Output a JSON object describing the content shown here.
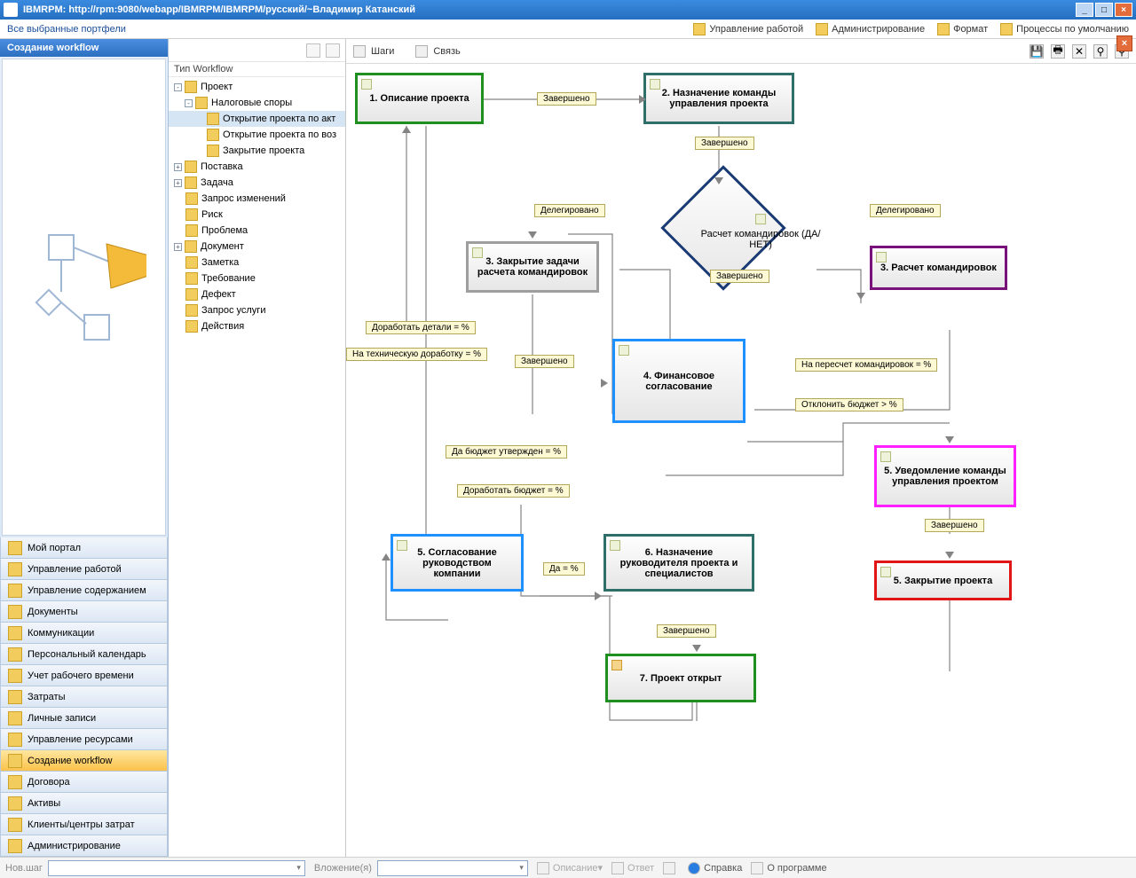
{
  "titlebar": "IBMRPM: http://rpm:9080/webapp/IBMRPM/IBMRPM/русский/~Владимир Катанский",
  "topbar": {
    "left": "Все выбранные портфели",
    "items": [
      "Управление работой",
      "Администрирование",
      "Формат",
      "Процессы по умолчанию"
    ]
  },
  "left": {
    "title": "Создание workflow",
    "nav": [
      "Мой портал",
      "Управление работой",
      "Управление содержанием",
      "Документы",
      "Коммуникации",
      "Персональный календарь",
      "Учет рабочего времени",
      "Затраты",
      "Личные записи",
      "Управление ресурсами",
      "Создание workflow",
      "Договора",
      "Активы",
      "Клиенты/центры затрат",
      "Администрирование"
    ],
    "selected": 10
  },
  "tree": {
    "header": "Тип Workflow",
    "rows": [
      {
        "lvl": 0,
        "exp": "-",
        "label": "Проект"
      },
      {
        "lvl": 1,
        "exp": "-",
        "label": "Налоговые споры"
      },
      {
        "lvl": 2,
        "exp": "",
        "label": "Открытие проекта по акт",
        "sel": true
      },
      {
        "lvl": 2,
        "exp": "",
        "label": "Открытие проекта по воз"
      },
      {
        "lvl": 2,
        "exp": "",
        "label": "Закрытие проекта"
      },
      {
        "lvl": 0,
        "exp": "+",
        "label": "Поставка"
      },
      {
        "lvl": 0,
        "exp": "+",
        "label": "Задача"
      },
      {
        "lvl": 0,
        "exp": "",
        "label": "Запрос изменений"
      },
      {
        "lvl": 0,
        "exp": "",
        "label": "Риск"
      },
      {
        "lvl": 0,
        "exp": "",
        "label": "Проблема"
      },
      {
        "lvl": 0,
        "exp": "+",
        "label": "Документ"
      },
      {
        "lvl": 0,
        "exp": "",
        "label": "Заметка"
      },
      {
        "lvl": 0,
        "exp": "",
        "label": "Требование"
      },
      {
        "lvl": 0,
        "exp": "",
        "label": "Дефект"
      },
      {
        "lvl": 0,
        "exp": "",
        "label": "Запрос услуги"
      },
      {
        "lvl": 0,
        "exp": "",
        "label": "Действия"
      }
    ]
  },
  "canvasToolbar": {
    "left": [
      "Шаги",
      "Связь"
    ]
  },
  "nodes": {
    "n1": "1. Описание проекта",
    "n2": "2. Назначение команды управления проекта",
    "n3a": "3. Закрытие задачи расчета командировок",
    "n3b": "3. Расчет командировок",
    "n4": "4. Финансовое согласование",
    "n5n": "5. Уведомление команды управления проектом",
    "n5c": "5. Согласование руководством компании",
    "n5z": "5. Закрытие проекта",
    "n6": "6. Назначение руководителя проекта и специалистов",
    "n7": "7. Проект открыт",
    "diamond": "Расчет командировок (ДА/НЕТ)"
  },
  "labels": {
    "done": "Завершено",
    "deleg": "Делегировано",
    "det": "Доработать детали = %",
    "tech": "На техническую доработку = %",
    "rec": "На пересчет командировок = %",
    "rej": "Отклонить бюджет > %",
    "appr": "Да бюджет утвержден = %",
    "bud": "Доработать бюджет = %",
    "da": "Да = %"
  },
  "bottom": {
    "newstep": "Нов.шаг",
    "attach": "Вложение(я)",
    "desc": "Описание",
    "ans": "Ответ",
    "help": "Справка",
    "about": "О программе"
  }
}
